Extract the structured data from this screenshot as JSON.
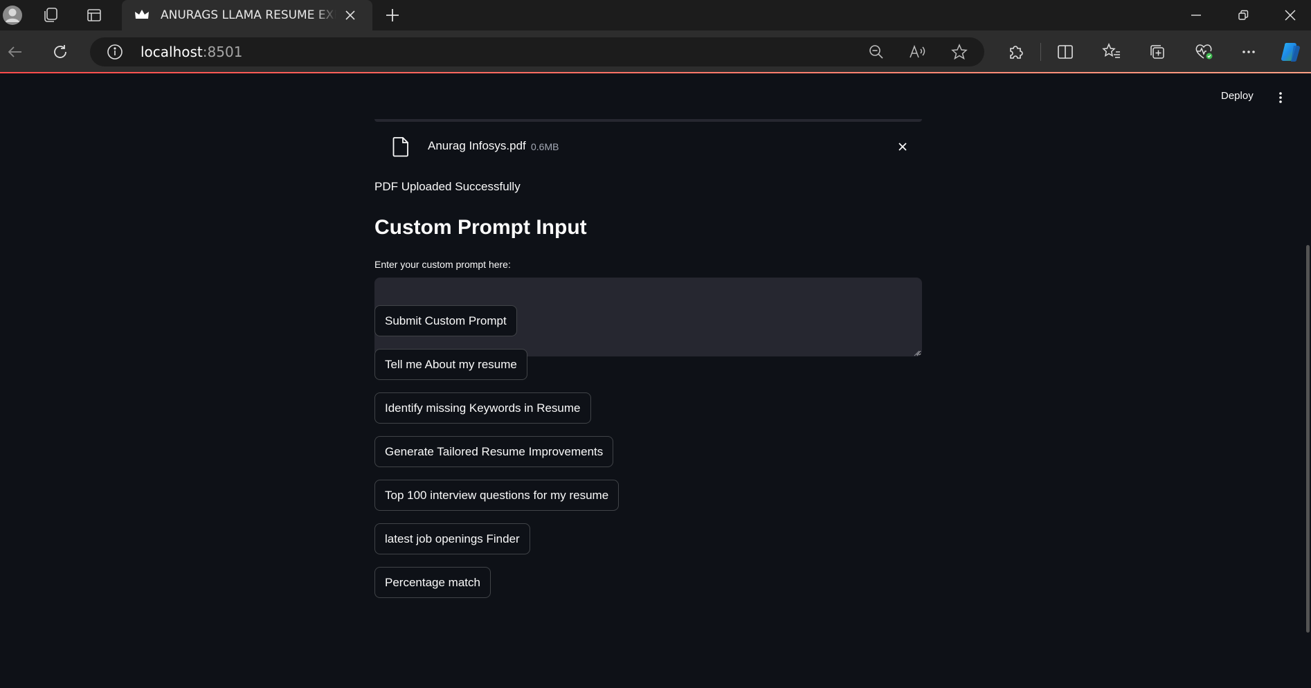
{
  "browser": {
    "tab_title": "ANURAGS LLAMA RESUME EXPERT",
    "url_host": "localhost",
    "url_port": ":8501",
    "icons": {
      "profile": "profile-avatar-icon",
      "workspaces": "workspaces-icon",
      "tab_actions": "tab-actions-icon",
      "tab_favicon": "streamlit-crown-icon",
      "tab_close": "close-icon",
      "new_tab": "plus-icon",
      "minimize": "minimize-icon",
      "restore": "restore-icon",
      "window_close": "close-icon",
      "back": "back-arrow-icon",
      "refresh": "refresh-icon",
      "site_info": "info-icon",
      "zoom_out": "zoom-out-icon",
      "read_aloud": "read-aloud-icon",
      "favorite": "star-icon",
      "extensions": "puzzle-icon",
      "split_screen": "split-screen-icon",
      "favorites": "favorites-list-icon",
      "collections": "collections-icon",
      "browser_essentials": "heart-pulse-icon",
      "more": "ellipsis-icon",
      "copilot": "copilot-icon"
    }
  },
  "header": {
    "deploy_label": "Deploy",
    "menu_icon": "vertical-ellipsis-icon"
  },
  "uploader": {
    "file_name": "Anurag Infosys.pdf",
    "file_size": "0.6MB",
    "file_icon": "document-icon",
    "remove_icon": "close-icon"
  },
  "status": {
    "message": "PDF Uploaded Successfully"
  },
  "custom_prompt": {
    "heading": "Custom Prompt Input",
    "label": "Enter your custom prompt here:",
    "value": ""
  },
  "buttons": [
    {
      "label": "Submit Custom Prompt"
    },
    {
      "label": "Tell me About my resume"
    },
    {
      "label": "Identify missing Keywords in Resume"
    },
    {
      "label": "Generate Tailored Resume Improvements"
    },
    {
      "label": "Top 100 interview questions for my resume"
    },
    {
      "label": "latest job openings Finder"
    },
    {
      "label": "Percentage match"
    }
  ],
  "colors": {
    "app_background": "#0e1117",
    "input_background": "#262730",
    "text": "#fafafa",
    "accent": "#ff4b4b"
  }
}
